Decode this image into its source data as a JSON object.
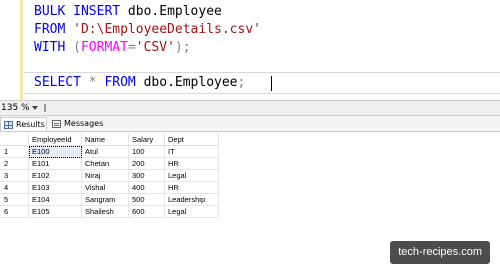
{
  "editor": {
    "lines": [
      [
        {
          "t": "BULK",
          "c": "kw"
        },
        {
          "t": " ",
          "c": ""
        },
        {
          "t": "INSERT",
          "c": "kw"
        },
        {
          "t": " dbo.Employee",
          "c": ""
        }
      ],
      [
        {
          "t": "FROM",
          "c": "kw"
        },
        {
          "t": " ",
          "c": ""
        },
        {
          "t": "'D:\\EmployeeDetails.csv'",
          "c": "str"
        }
      ],
      [
        {
          "t": "WITH",
          "c": "kw"
        },
        {
          "t": " ",
          "c": ""
        },
        {
          "t": "(",
          "c": "gray"
        },
        {
          "t": "FORMAT",
          "c": "fn"
        },
        {
          "t": "=",
          "c": "gray"
        },
        {
          "t": "'CSV'",
          "c": "str"
        },
        {
          "t": ");",
          "c": "gray"
        }
      ],
      [],
      [
        {
          "t": "SELECT",
          "c": "kw"
        },
        {
          "t": " ",
          "c": ""
        },
        {
          "t": "*",
          "c": "gray"
        },
        {
          "t": " ",
          "c": ""
        },
        {
          "t": "FROM",
          "c": "kw"
        },
        {
          "t": " dbo.Employee",
          "c": ""
        },
        {
          "t": ";",
          "c": "gray"
        }
      ]
    ]
  },
  "status": {
    "zoom": "135 %"
  },
  "tabs": {
    "results": "Results",
    "messages": "Messages"
  },
  "results": {
    "columns": [
      "EmployeeId",
      "Name",
      "Salary",
      "Dept"
    ],
    "rows": [
      {
        "n": "1",
        "id": "E100",
        "name": "Atul",
        "salary": "100",
        "dept": "IT"
      },
      {
        "n": "2",
        "id": "E101",
        "name": "Chetan",
        "salary": "200",
        "dept": "HR"
      },
      {
        "n": "3",
        "id": "E102",
        "name": "Niraj",
        "salary": "300",
        "dept": "Legal"
      },
      {
        "n": "4",
        "id": "E103",
        "name": "Vishal",
        "salary": "400",
        "dept": "HR"
      },
      {
        "n": "5",
        "id": "E104",
        "name": "Sangram",
        "salary": "500",
        "dept": "Leadership"
      },
      {
        "n": "6",
        "id": "E105",
        "name": "Shailesh",
        "salary": "600",
        "dept": "Legal"
      }
    ]
  },
  "watermark": "tech-recipes.com"
}
